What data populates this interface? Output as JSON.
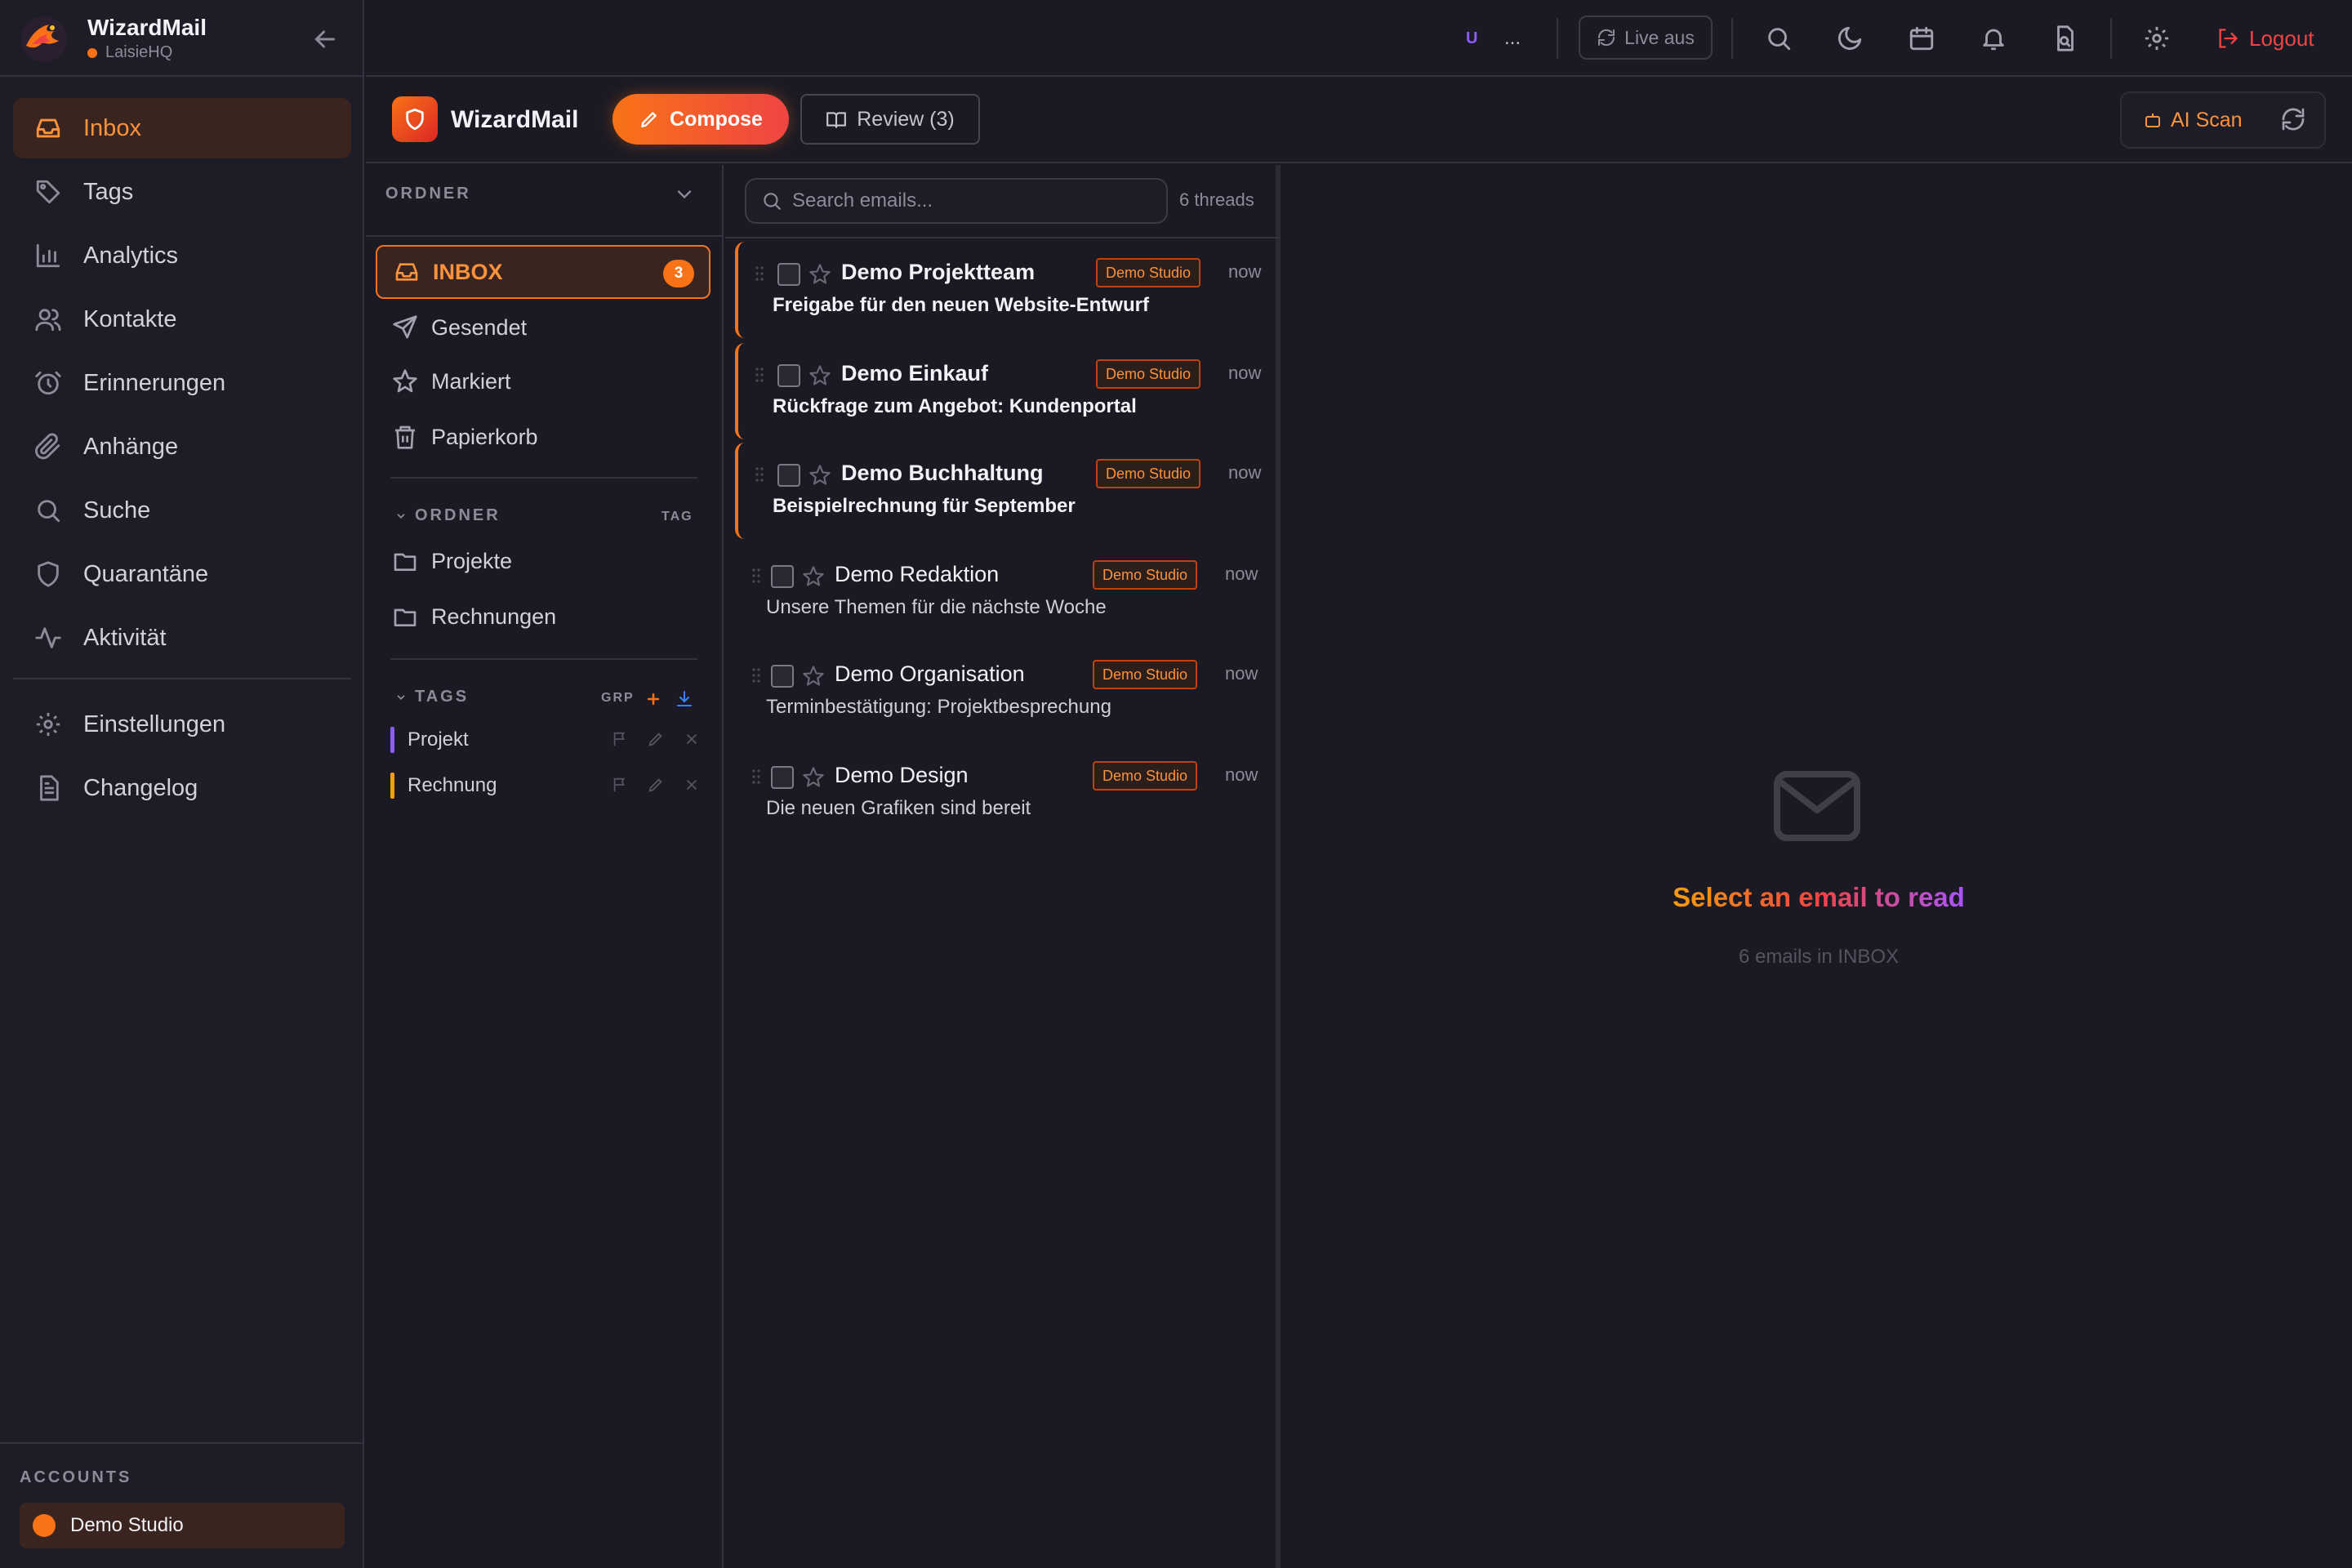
{
  "app": {
    "name": "WizardMail",
    "workspace": "LaisieHQ"
  },
  "sidebar": {
    "items": [
      {
        "label": "Inbox",
        "icon": "inbox-icon",
        "active": true
      },
      {
        "label": "Tags",
        "icon": "tag-icon"
      },
      {
        "label": "Analytics",
        "icon": "bar-chart-icon"
      },
      {
        "label": "Kontakte",
        "icon": "users-icon"
      },
      {
        "label": "Erinnerungen",
        "icon": "alarm-clock-icon"
      },
      {
        "label": "Anhänge",
        "icon": "paperclip-icon"
      },
      {
        "label": "Suche",
        "icon": "search-icon"
      },
      {
        "label": "Quarantäne",
        "icon": "shield-icon"
      },
      {
        "label": "Aktivität",
        "icon": "activity-icon"
      }
    ],
    "bottom_items": [
      {
        "label": "Einstellungen",
        "icon": "gear-icon"
      },
      {
        "label": "Changelog",
        "icon": "file-text-icon"
      }
    ],
    "accounts_heading": "ACCOUNTS",
    "account": "Demo Studio"
  },
  "topbar": {
    "user_initial": "U",
    "more": "...",
    "live_label": "Live aus",
    "logout_label": "Logout"
  },
  "subheader": {
    "brand": "WizardMail",
    "compose_label": "Compose",
    "review_label": "Review (3)",
    "ai_scan_label": "AI Scan"
  },
  "folders": {
    "heading": "ORDNER",
    "system": [
      {
        "label": "INBOX",
        "icon": "inbox-icon",
        "count": "3",
        "active": true
      },
      {
        "label": "Gesendet",
        "icon": "send-icon"
      },
      {
        "label": "Markiert",
        "icon": "star-icon"
      },
      {
        "label": "Papierkorb",
        "icon": "trash-icon"
      }
    ],
    "custom_heading": "ORDNER",
    "custom_right": "TAG",
    "custom": [
      {
        "label": "Projekte",
        "icon": "folder-icon"
      },
      {
        "label": "Rechnungen",
        "icon": "folder-icon"
      }
    ],
    "tags_heading": "TAGS",
    "tags_right": "GRP",
    "tags": [
      {
        "label": "Projekt",
        "color": "#8b5cf6"
      },
      {
        "label": "Rechnung",
        "color": "#f59e0b"
      }
    ]
  },
  "list": {
    "search_placeholder": "Search emails...",
    "thread_count": "6 threads",
    "emails": [
      {
        "sender": "Demo Projektteam",
        "subject": "Freigabe für den neuen Website-Entwurf",
        "account": "Demo Studio",
        "time": "now",
        "unread": true
      },
      {
        "sender": "Demo Einkauf",
        "subject": "Rückfrage zum Angebot: Kundenportal",
        "account": "Demo Studio",
        "time": "now",
        "unread": true
      },
      {
        "sender": "Demo Buchhaltung",
        "subject": "Beispielrechnung für September",
        "account": "Demo Studio",
        "time": "now",
        "unread": true
      },
      {
        "sender": "Demo Redaktion",
        "subject": "Unsere Themen für die nächste Woche",
        "account": "Demo Studio",
        "time": "now",
        "unread": false
      },
      {
        "sender": "Demo Organisation",
        "subject": "Terminbestätigung: Projektbesprechung",
        "account": "Demo Studio",
        "time": "now",
        "unread": false
      },
      {
        "sender": "Demo Design",
        "subject": "Die neuen Grafiken sind bereit",
        "account": "Demo Studio",
        "time": "now",
        "unread": false
      }
    ]
  },
  "reader": {
    "empty_title": "Select an email to read",
    "empty_sub": "6 emails in INBOX"
  },
  "colors": {
    "accent": "#f97316",
    "danger": "#ef4444",
    "background": "#1b1a24"
  }
}
